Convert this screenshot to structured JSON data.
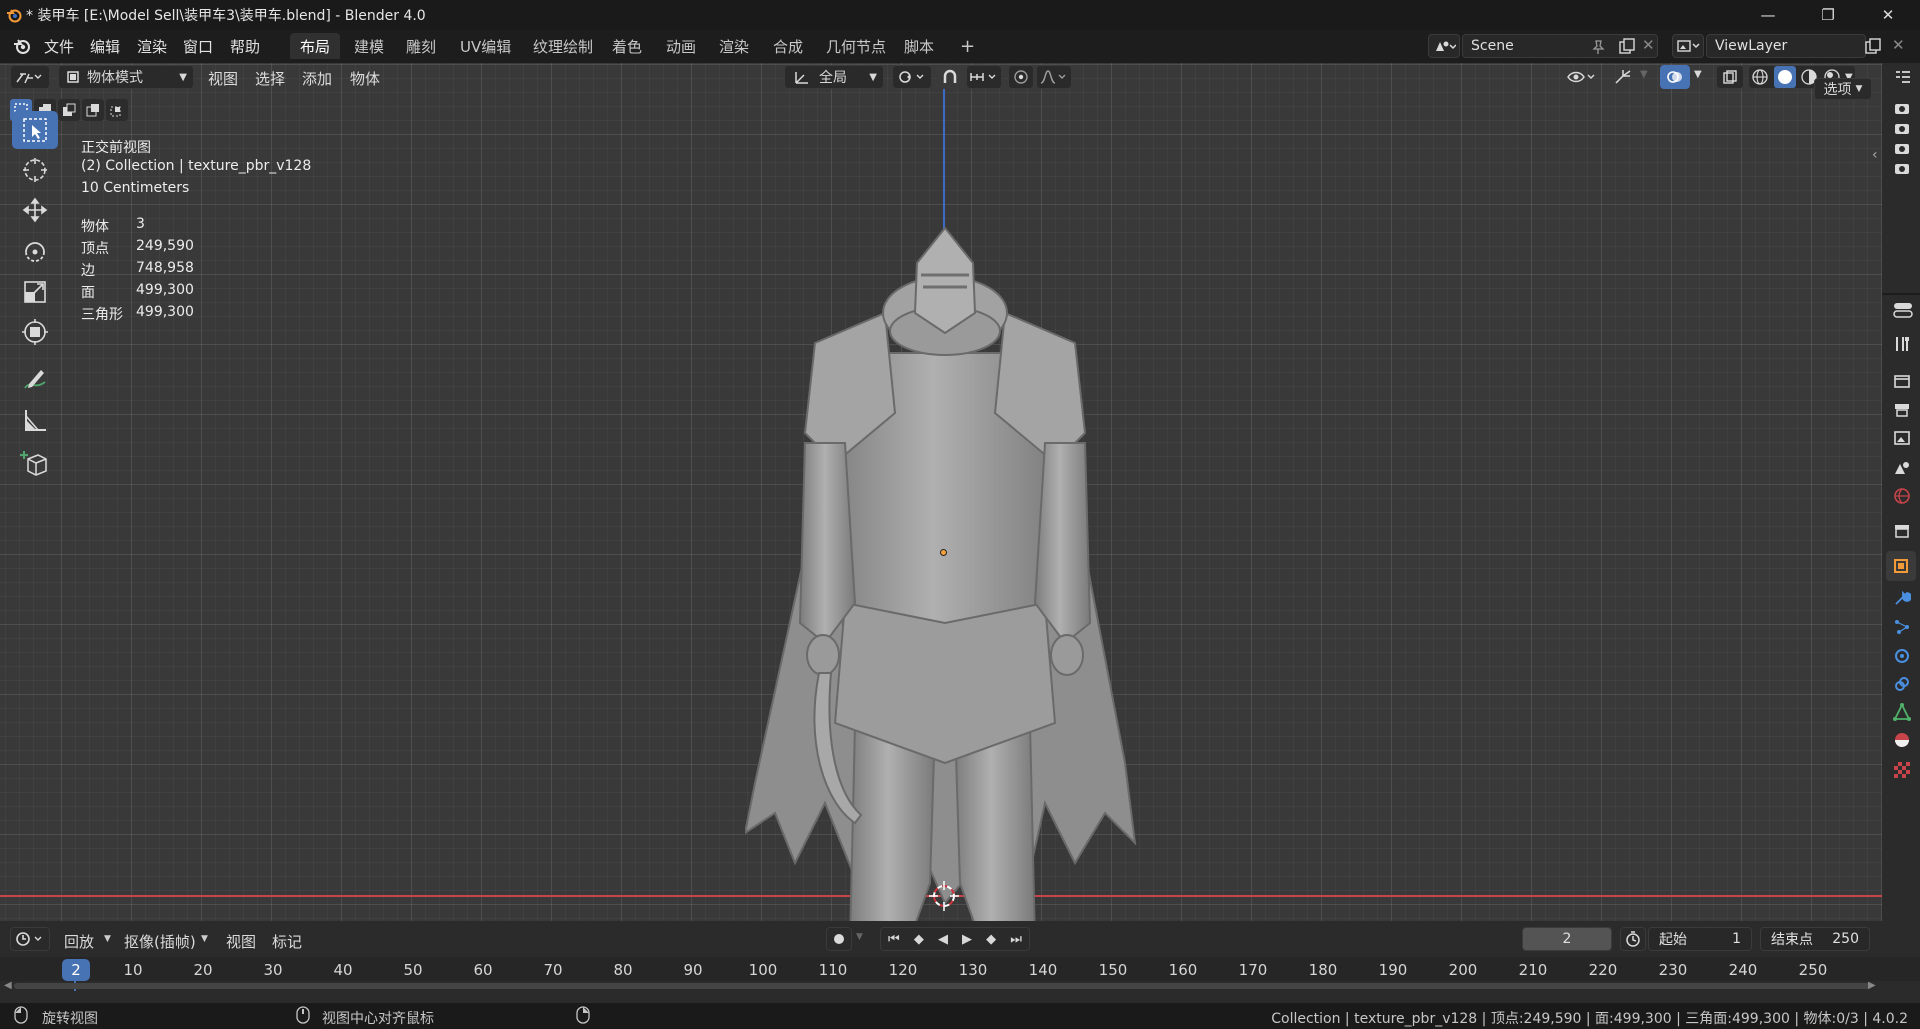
{
  "window": {
    "title": "* 装甲车 [E:\\Model Sell\\装甲车3\\装甲车.blend] - Blender 4.0",
    "minimize": "—",
    "maximize": "❐",
    "close": "✕"
  },
  "menu": {
    "items": [
      "文件",
      "编辑",
      "渲染",
      "窗口",
      "帮助"
    ]
  },
  "workspaces": {
    "tabs": [
      "布局",
      "建模",
      "雕刻",
      "UV编辑",
      "纹理绘制",
      "着色",
      "动画",
      "渲染",
      "合成",
      "几何节点",
      "脚本"
    ],
    "active_index": 0,
    "add_label": "+"
  },
  "scene": {
    "name": "Scene"
  },
  "view_layer": {
    "name": "ViewLayer"
  },
  "viewport_header": {
    "mode": "物体模式",
    "menus": [
      "视图",
      "选择",
      "添加",
      "物体"
    ],
    "transform_orientation": "全局",
    "options_label": "选项"
  },
  "overlay_info": {
    "view_name": "正交前视图",
    "collection": "(2) Collection | texture_pbr_v128",
    "scale": "10 Centimeters",
    "stats": [
      {
        "label": "物体",
        "value": "3"
      },
      {
        "label": "顶点",
        "value": "249,590"
      },
      {
        "label": "边",
        "value": "748,958"
      },
      {
        "label": "面",
        "value": "499,300"
      },
      {
        "label": "三角形",
        "value": "499,300"
      }
    ]
  },
  "tools": [
    "select-box-icon",
    "cursor-icon",
    "move-icon",
    "rotate-icon",
    "scale-icon",
    "transform-icon",
    "annotate-icon",
    "measure-icon",
    "add-cube-icon"
  ],
  "timeline": {
    "menus": [
      "回放",
      "抠像(插帧)",
      "视图",
      "标记"
    ],
    "current_frame": "2",
    "start_label": "起始",
    "start_value": "1",
    "end_label": "结束点",
    "end_value": "250",
    "ticks": [
      "10",
      "20",
      "30",
      "40",
      "50",
      "60",
      "70",
      "80",
      "90",
      "100",
      "110",
      "120",
      "130",
      "140",
      "150",
      "160",
      "170",
      "180",
      "190",
      "200",
      "210",
      "220",
      "230",
      "240",
      "250"
    ]
  },
  "status_bar": {
    "left_action": "旋转视图",
    "middle_action": "视图中心对齐鼠标",
    "info": "Collection | texture_pbr_v128 | 顶点:249,590 | 面:499,300 | 三角面:499,300 | 物体:0/3 | 4.0.2"
  },
  "colors": {
    "accent": "#4772b3",
    "viewport_bg": "#393939",
    "axis_x": "#c8444b",
    "axis_z": "#3f6bc4",
    "model": "#9a9a9a"
  }
}
